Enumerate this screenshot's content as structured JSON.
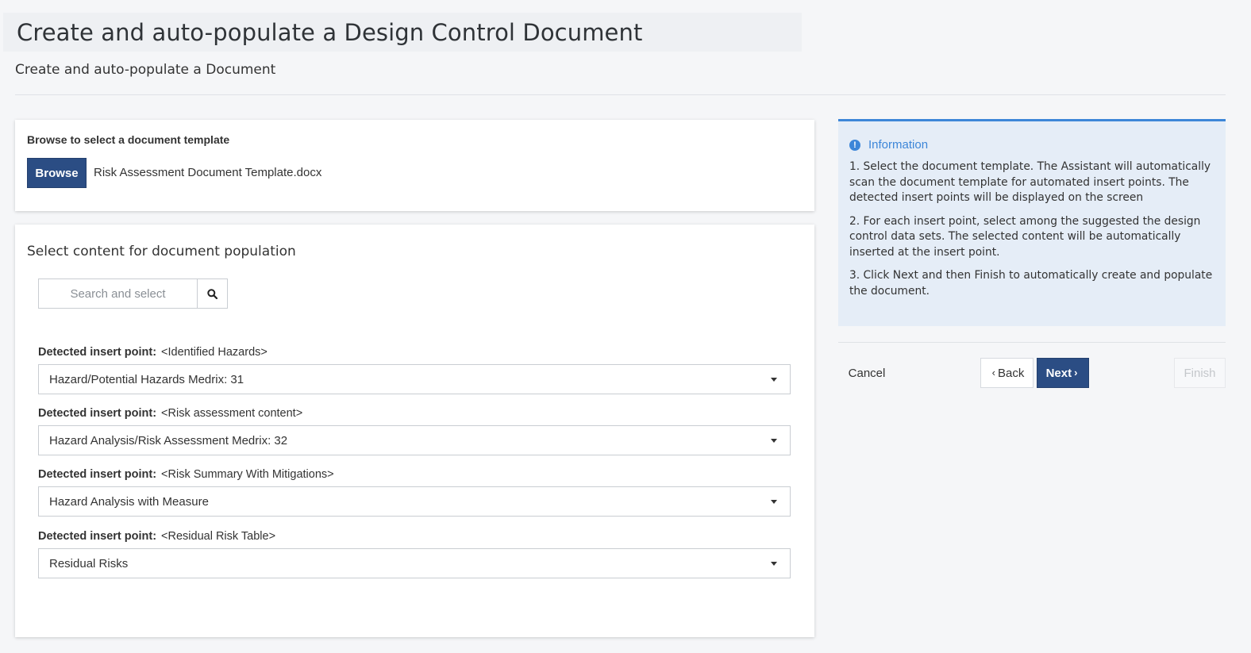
{
  "header": {
    "title": "Create and auto-populate a Design Control Document",
    "subtitle": "Create and auto-populate a Document"
  },
  "template_card": {
    "label": "Browse to select a document template",
    "browse_label": "Browse",
    "file_name": "Risk Assessment Document Template.docx"
  },
  "content_card": {
    "title": "Select content for document population",
    "search": {
      "placeholder": "Search and select",
      "value": ""
    },
    "insert_label": "Detected insert point:",
    "insert_points": [
      {
        "tag": "<Identified Hazards>",
        "selected": "Hazard/Potential Hazards Medrix: 31"
      },
      {
        "tag": "<Risk assessment content>",
        "selected": "Hazard Analysis/Risk Assessment Medrix: 32"
      },
      {
        "tag": "<Risk Summary With Mitigations>",
        "selected": "Hazard Analysis with Measure"
      },
      {
        "tag": "<Residual Risk Table>",
        "selected": "Residual Risks"
      }
    ]
  },
  "info": {
    "heading": "Information",
    "icon": "info-circle-icon",
    "steps": [
      "1. Select the document template. The Assistant will automatically scan the document template for automated insert points. The detected insert points will be displayed on the screen",
      "2.  For each insert point, select among the suggested the design control data sets. The selected content will be automatically inserted at the insert point.",
      "3. Click Next and then Finish to automatically create and populate the document."
    ]
  },
  "wizard_nav": {
    "cancel_label": "Cancel",
    "back_label": "Back",
    "next_label": "Next",
    "finish_label": "Finish"
  },
  "colors": {
    "primary": "#2b4d84",
    "info_accent": "#3d86d8",
    "info_bg": "#e5edf7"
  }
}
